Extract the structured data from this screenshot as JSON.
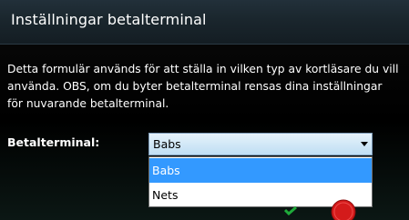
{
  "window": {
    "title": "Inställningar betalterminal"
  },
  "description": "Detta formulär används för att ställa in vilken typ av kortläsare du vill använda. OBS, om du byter betalterminal rensas dina inställningar för nuvarande betalterminal.",
  "terminal_field": {
    "label": "Betalterminal:",
    "selected_value": "Babs",
    "options": [
      "Babs",
      "Nets"
    ],
    "highlighted_option": "Babs"
  },
  "actions": {
    "confirm_icon": "checkmark-icon",
    "cancel_icon": "cancel-icon"
  },
  "colors": {
    "highlight": "#3399ff",
    "confirm": "#1faa3a",
    "cancel": "#d41b1b"
  }
}
